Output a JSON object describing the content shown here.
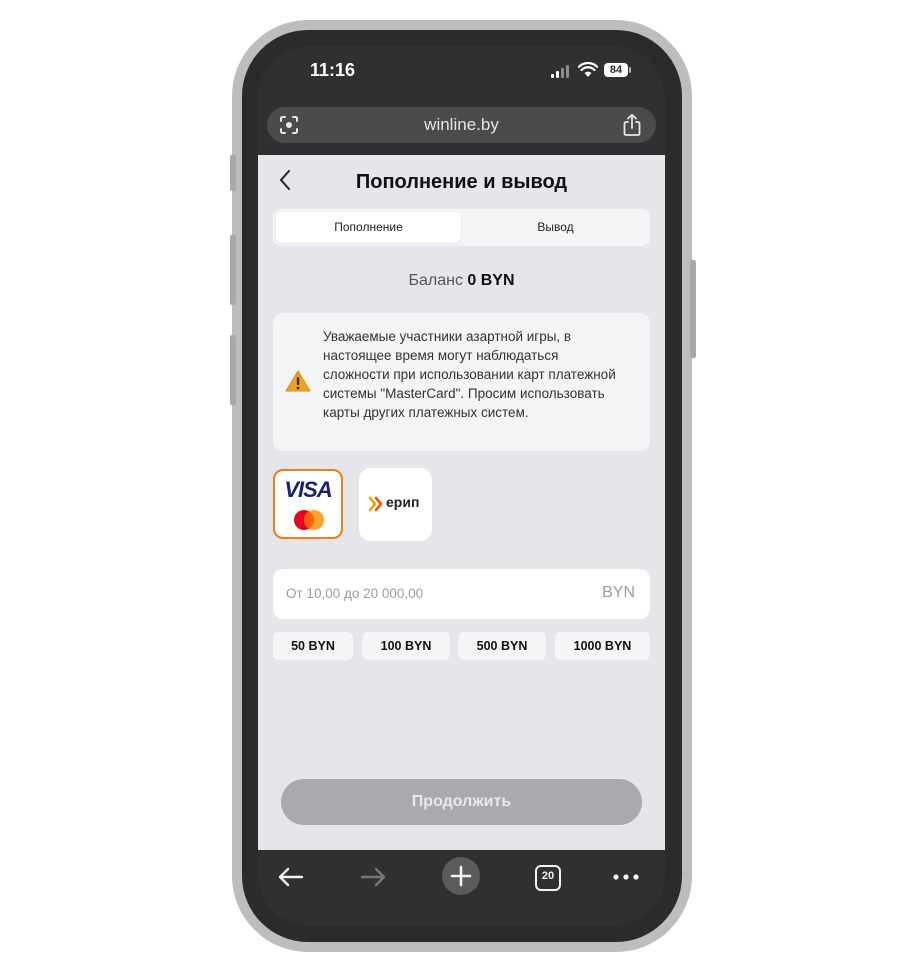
{
  "status": {
    "time": "11:16",
    "battery": "84"
  },
  "browser": {
    "url": "winline.by",
    "tabs_count": "20"
  },
  "page": {
    "title": "Пополнение и вывод",
    "tabs": [
      {
        "label": "Пополнение",
        "active": true
      },
      {
        "label": "Вывод",
        "active": false
      }
    ],
    "balance_label": "Баланс",
    "balance_value": "0 BYN",
    "notice": "Уважаемые участники азартной игры, в настоящее время могут наблюдаться сложности при использовании карт платежной системы \"MasterCard\". Просим использовать карты других платежных систем.",
    "payment_methods": [
      {
        "label": "VISA",
        "selected": true
      },
      {
        "label": "ерип",
        "selected": false
      }
    ],
    "amount_placeholder": "От 10,00 до 20 000,00",
    "amount_currency": "BYN",
    "quick_amounts": [
      "50 BYN",
      "100 BYN",
      "500 BYN",
      "1000 BYN"
    ],
    "continue_label": "Продолжить"
  },
  "colors": {
    "accent": "#f07d1a",
    "background": "#e4e6ea",
    "cta_disabled": "#a9aaae"
  }
}
